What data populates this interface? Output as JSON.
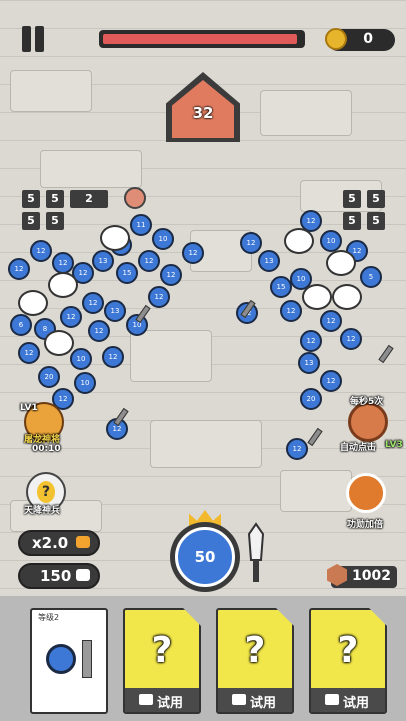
{
  "hud": {
    "boss_hp_percent": 98,
    "coins": "0",
    "base_count": "32"
  },
  "board": {
    "tiles": [
      "5",
      "5",
      "2",
      "5",
      "5"
    ],
    "right_tiles": [
      "5",
      "5",
      "5",
      "5"
    ],
    "left_level": "LV1",
    "left_countdown": "00:10",
    "left_upgrade_label": "屠龙神将",
    "sky_soldier_label": "天降神兵",
    "auto_click_prefix": "每秒5次",
    "auto_click_label": "自动点击",
    "auto_click_level": "LV3",
    "boost_label": "功勋加倍",
    "unit_numbers": [
      "12",
      "12",
      "12",
      "12",
      "13",
      "15",
      "12",
      "10",
      "11",
      "5",
      "6",
      "8",
      "12",
      "12",
      "13",
      "10",
      "12",
      "12",
      "12",
      "10",
      "20",
      "12",
      "12",
      "10",
      "12",
      "12",
      "12",
      "12",
      "13",
      "15",
      "10",
      "12",
      "10",
      "12",
      "5",
      "12",
      "12",
      "12",
      "12",
      "13",
      "12",
      "20",
      "12",
      "12"
    ]
  },
  "controls": {
    "speed_label": "x2.0",
    "units_count": "150",
    "spawn_value": "50",
    "gems": "1002"
  },
  "cards": [
    {
      "level": "等级2",
      "type": "unit"
    },
    {
      "label": "?",
      "try_label": "试用"
    },
    {
      "label": "?",
      "try_label": "试用"
    },
    {
      "label": "?",
      "try_label": "试用"
    }
  ],
  "colors": {
    "unit_blue": "#3d78d6",
    "hp_red": "#e05a5a",
    "card_yellow": "#f1e64a",
    "coin_gold": "#e7b52c"
  }
}
